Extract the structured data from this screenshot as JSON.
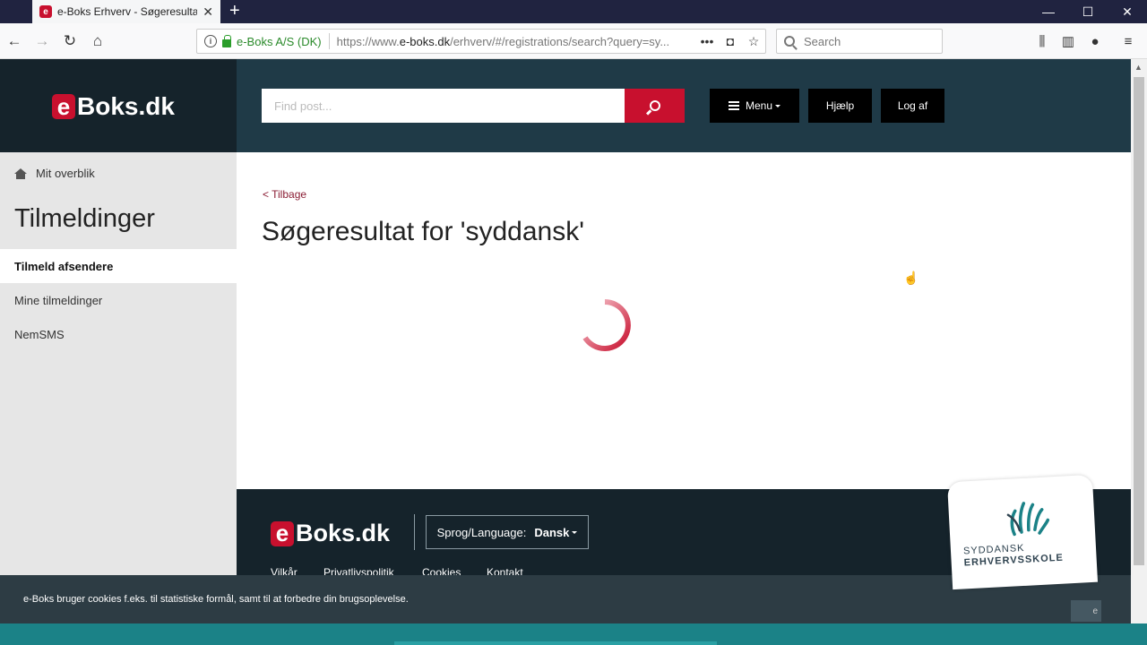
{
  "browser": {
    "tab_title": "e-Boks Erhverv - Søgeresultat",
    "favicon_letter": "e",
    "site_identity": "e-Boks A/S (DK)",
    "url_prefix": "https://www.",
    "url_domain": "e-boks.dk",
    "url_rest": "/erhverv/#/registrations/search?query=sy...",
    "search_placeholder": "Search",
    "icons": [
      "back-icon",
      "forward-icon",
      "reload-icon",
      "home-icon",
      "info-icon",
      "lock-icon",
      "more-icon",
      "pocket-icon",
      "bookmark-star-icon",
      "library-icon",
      "sidebar-icon",
      "extension-icon",
      "menu-icon",
      "new-tab-icon",
      "minimize-icon",
      "maximize-icon",
      "close-icon"
    ]
  },
  "header": {
    "logo_e": "e",
    "logo_text": "Boks.dk",
    "search_placeholder": "Find post...",
    "menu_label": "Menu",
    "help_label": "Hjælp",
    "logout_label": "Log af"
  },
  "sidebar": {
    "overview_label": "Mit overblik",
    "title": "Tilmeldinger",
    "items": [
      {
        "label": "Tilmeld afsendere",
        "active": true
      },
      {
        "label": "Mine tilmeldinger",
        "active": false
      },
      {
        "label": "NemSMS",
        "active": false
      }
    ]
  },
  "main": {
    "back_label": "Tilbage",
    "heading": "Søgeresultat for 'syddansk'",
    "loading": true
  },
  "footer": {
    "logo_e": "e",
    "logo_text": "Boks.dk",
    "language_label": "Sprog/Language:",
    "language_value": "Dansk",
    "links": [
      "Vilkår",
      "Privatlivspolitik",
      "Cookies",
      "Kontakt"
    ]
  },
  "cookie_notice": {
    "text": "e-Boks bruger cookies f.eks. til statistiske formål, samt til at forbedre din brugsoplevelse.",
    "button_label": "e"
  },
  "overlay_badge": {
    "line1": "SYDDANSK",
    "line2": "ERHVERVSSKOLE"
  },
  "colors": {
    "brand_red": "#c8102e",
    "header_dark": "#15232b",
    "header_blue": "#1f3a47",
    "teal": "#1b8287"
  }
}
